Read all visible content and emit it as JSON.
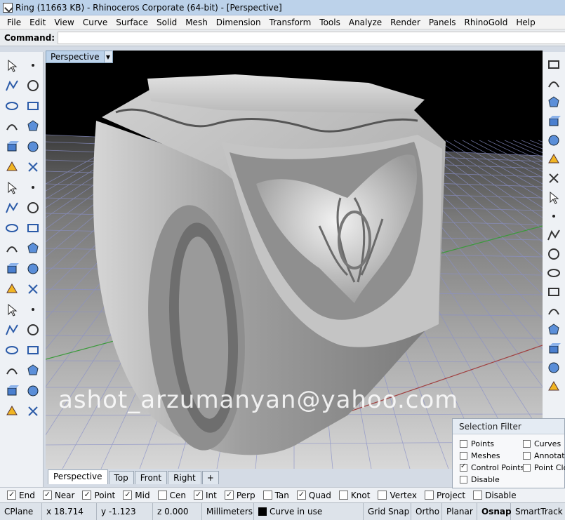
{
  "window": {
    "title": "Ring (11663 KB) - Rhinoceros Corporate (64-bit) - [Perspective]"
  },
  "menu": [
    "File",
    "Edit",
    "View",
    "Curve",
    "Surface",
    "Solid",
    "Mesh",
    "Dimension",
    "Transform",
    "Tools",
    "Analyze",
    "Render",
    "Panels",
    "RhinoGold",
    "Help"
  ],
  "command": {
    "label": "Command:",
    "value": ""
  },
  "viewport": {
    "name": "Perspective",
    "watermark": "ashot_arzumanyan@yahoo.com"
  },
  "left_tools": [
    "select-arrow-icon",
    "point-icon",
    "polyline-icon",
    "curve-points-icon",
    "circle-icon",
    "ellipse-icon",
    "polygon-icon",
    "rectangle-icon",
    "circle-center-icon",
    "fillet-icon",
    "surface-pts-icon",
    "extrude-surface-icon",
    "box-icon",
    "sphere-icon",
    "cylinder-icon",
    "mesh-plane-icon",
    "explode-icon",
    "trim-icon",
    "split-icon",
    "boolean-icon",
    "group-icon",
    "ungroup-icon",
    "offset-icon",
    "fillet-curve-icon",
    "text-icon",
    "block-icon",
    "array-icon",
    "edit-icon",
    "solid-box-icon",
    "dimension-icon",
    "grid-array-icon",
    "numbered-icon",
    "pipe-icon",
    "check-icon",
    "bucket-icon",
    "render-icon"
  ],
  "right_tools": [
    "new-document-icon",
    "open-folder-icon",
    "save-icon",
    "print-icon",
    "import-icon",
    "cut-icon",
    "copy-icon",
    "paste-icon",
    "undo-icon",
    "pan-icon",
    "rotate-view-icon",
    "zoom-icon",
    "zoom-window-icon",
    "zoom-extents-icon",
    "zoom-selected-icon",
    "rotate-icon",
    "four-view-icon",
    "car-icon"
  ],
  "selection_filter": {
    "title": "Selection Filter",
    "items": [
      {
        "label": "Points",
        "checked": false
      },
      {
        "label": "Curves",
        "checked": false
      },
      {
        "label": "Meshes",
        "checked": false
      },
      {
        "label": "Annotatio",
        "checked": false
      },
      {
        "label": "Control Points",
        "checked": true
      },
      {
        "label": "Point Clou",
        "checked": false
      },
      {
        "label": "Disable",
        "checked": false
      }
    ]
  },
  "view_tabs": [
    "Perspective",
    "Top",
    "Front",
    "Right",
    "+"
  ],
  "osnap": [
    {
      "label": "End",
      "checked": true
    },
    {
      "label": "Near",
      "checked": true
    },
    {
      "label": "Point",
      "checked": true
    },
    {
      "label": "Mid",
      "checked": true
    },
    {
      "label": "Cen",
      "checked": false
    },
    {
      "label": "Int",
      "checked": true
    },
    {
      "label": "Perp",
      "checked": true
    },
    {
      "label": "Tan",
      "checked": false
    },
    {
      "label": "Quad",
      "checked": true
    },
    {
      "label": "Knot",
      "checked": false
    },
    {
      "label": "Vertex",
      "checked": false
    },
    {
      "label": "Project",
      "checked": false
    },
    {
      "label": "Disable",
      "checked": false
    }
  ],
  "status": {
    "cplane": "CPlane",
    "x": "x 18.714",
    "y": "y -1.123",
    "z": "z 0.000",
    "units": "Millimeters",
    "layer": "Curve in use",
    "grid_snap": "Grid Snap",
    "ortho": "Ortho",
    "planar": "Planar",
    "osnap": "Osnap",
    "smart_track": "SmartTrack"
  },
  "colors": {
    "title_bar": "#bcd2ea",
    "viewport_bg": "#000000",
    "grid_line": "#8a90c8",
    "ring_surface": "#b4b4b4"
  }
}
